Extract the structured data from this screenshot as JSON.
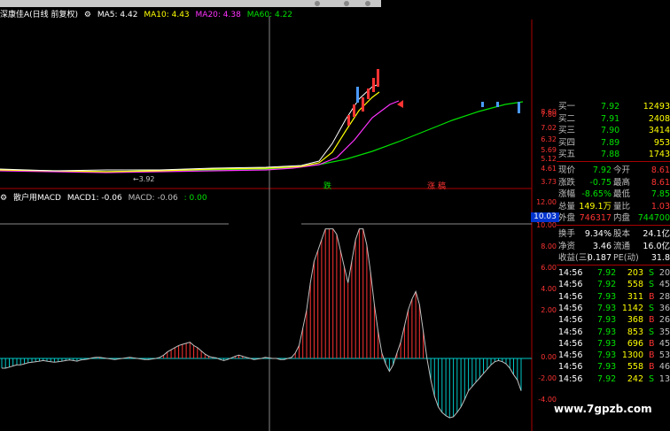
{
  "main_chart": {
    "stock_name": "深康佳A(日线 前复权)",
    "ma_labels": [
      {
        "text": "MA5: 4.42",
        "color": "#ffffff"
      },
      {
        "text": "MA10: 4.43",
        "color": "#ffff00"
      },
      {
        "text": "MA20: 4.38",
        "color": "#ff33ff"
      },
      {
        "text": "MA60: 4.22",
        "color": "#00e000"
      }
    ],
    "price_axis": [
      "8.60",
      "7.80",
      "7.02",
      "6.32",
      "5.69",
      "5.12",
      "4.61",
      "3.73"
    ],
    "low_marker": "3.92",
    "signal_labels": [
      {
        "text": "跌",
        "color": "#00e000"
      },
      {
        "text": "涨",
        "color": "#ff3333"
      },
      {
        "text": "稿",
        "color": "#ff3333"
      }
    ]
  },
  "macd_chart": {
    "indicator_name": "散户用MACD",
    "macd1_label": "MACD1: -0.06",
    "macd_label": "MACD: -0.06",
    "zero_label": ": 0.00",
    "axis": [
      "12.00",
      "10.00",
      "8.00",
      "6.00",
      "4.00",
      "2.00",
      "0.00",
      "-2.00",
      "-4.00"
    ],
    "current_value": "10.03",
    "histogram_values": [
      -0.9,
      -0.9,
      -0.8,
      -0.7,
      -0.6,
      -0.6,
      -0.5,
      -0.4,
      -0.35,
      -0.3,
      -0.25,
      -0.2,
      -0.25,
      -0.3,
      -0.35,
      -0.3,
      -0.25,
      -0.2,
      -0.15,
      -0.2,
      -0.25,
      -0.15,
      -0.1,
      -0.05,
      0.05,
      0.1,
      0.1,
      0.05,
      0.0,
      -0.05,
      -0.1,
      -0.05,
      0.0,
      0.05,
      0.1,
      0.05,
      0.0,
      -0.05,
      -0.1,
      -0.1,
      -0.05,
      0.0,
      0.1,
      0.3,
      0.6,
      0.8,
      1.0,
      1.2,
      1.3,
      1.4,
      1.5,
      1.2,
      1.0,
      0.7,
      0.4,
      0.2,
      0.1,
      0.05,
      -0.1,
      -0.2,
      -0.1,
      0.05,
      0.2,
      0.3,
      0.2,
      0.1,
      0.0,
      -0.1,
      -0.05,
      0.0,
      0.1,
      0.05,
      0.0,
      0.0,
      -0.1,
      -0.1,
      0.0,
      0.1,
      0.5,
      1.2,
      2.8,
      4.5,
      7.0,
      9.0,
      10.0,
      11.0,
      12.0,
      12.0,
      12.0,
      11.5,
      10.0,
      8.5,
      7.0,
      9.0,
      11.0,
      12.0,
      12.0,
      10.5,
      8.0,
      5.0,
      2.5,
      0.5,
      -0.5,
      -1.2,
      -0.6,
      0.5,
      1.5,
      3.0,
      4.5,
      5.5,
      6.2,
      5.0,
      2.5,
      0.0,
      -2.0,
      -3.5,
      -4.5,
      -5.0,
      -5.3,
      -5.5,
      -5.4,
      -5.0,
      -4.5,
      -3.8,
      -3.0,
      -2.6,
      -2.2,
      -1.8,
      -1.4,
      -1.0,
      -0.6,
      -0.3,
      -0.2,
      -0.3,
      -0.5,
      -0.9,
      -1.5,
      -2.0,
      -3.0
    ]
  },
  "quote_panel": {
    "bids": [
      {
        "label": "买一",
        "price": "7.92",
        "vol": "12493"
      },
      {
        "label": "买二",
        "price": "7.91",
        "vol": "2408"
      },
      {
        "label": "买三",
        "price": "7.90",
        "vol": "3414"
      },
      {
        "label": "买四",
        "price": "7.89",
        "vol": "953"
      },
      {
        "label": "买五",
        "price": "7.88",
        "vol": "1743"
      }
    ],
    "stats": [
      {
        "l1": "现价",
        "v1": "7.92",
        "c1": "#00e000",
        "l2": "今开",
        "v2": "8.61",
        "c2": "#ff3333"
      },
      {
        "l1": "涨跌",
        "v1": "-0.75",
        "c1": "#00e000",
        "l2": "最高",
        "v2": "8.61",
        "c2": "#ff3333"
      },
      {
        "l1": "涨幅",
        "v1": "-8.65%",
        "c1": "#00e000",
        "l2": "最低",
        "v2": "7.85",
        "c2": "#00e000"
      },
      {
        "l1": "总量",
        "v1": "149.1万",
        "c1": "#ffff00",
        "l2": "量比",
        "v2": "1.03",
        "c2": "#ff3333"
      },
      {
        "l1": "外盘",
        "v1": "746317",
        "c1": "#ff3333",
        "l2": "内盘",
        "v2": "744700",
        "c2": "#00e000"
      }
    ],
    "fundamentals": [
      {
        "l1": "换手",
        "v1": "9.34%",
        "l2": "股本",
        "v2": "24.1亿"
      },
      {
        "l1": "净资",
        "v1": "3.46",
        "l2": "流通",
        "v2": "16.0亿"
      },
      {
        "l1": "收益(三)",
        "v1": "0.187",
        "l2": "PE(动)",
        "v2": "31.8"
      }
    ],
    "ticks": [
      {
        "time": "14:56",
        "price": "7.92",
        "vol": "203",
        "side": "S",
        "n": "20"
      },
      {
        "time": "14:56",
        "price": "7.92",
        "vol": "558",
        "side": "S",
        "n": "45"
      },
      {
        "time": "14:56",
        "price": "7.93",
        "vol": "311",
        "side": "B",
        "n": "28"
      },
      {
        "time": "14:56",
        "price": "7.93",
        "vol": "1142",
        "side": "S",
        "n": "36"
      },
      {
        "time": "14:56",
        "price": "7.93",
        "vol": "368",
        "side": "B",
        "n": "26"
      },
      {
        "time": "14:56",
        "price": "7.93",
        "vol": "853",
        "side": "S",
        "n": "35"
      },
      {
        "time": "14:56",
        "price": "7.93",
        "vol": "696",
        "side": "B",
        "n": "45"
      },
      {
        "time": "14:56",
        "price": "7.93",
        "vol": "1300",
        "side": "B",
        "n": "53"
      },
      {
        "time": "14:56",
        "price": "7.93",
        "vol": "558",
        "side": "B",
        "n": "46"
      },
      {
        "time": "14:56",
        "price": "7.92",
        "vol": "242",
        "side": "S",
        "n": "13"
      }
    ]
  },
  "watermark": "www.7gpzb.com"
}
